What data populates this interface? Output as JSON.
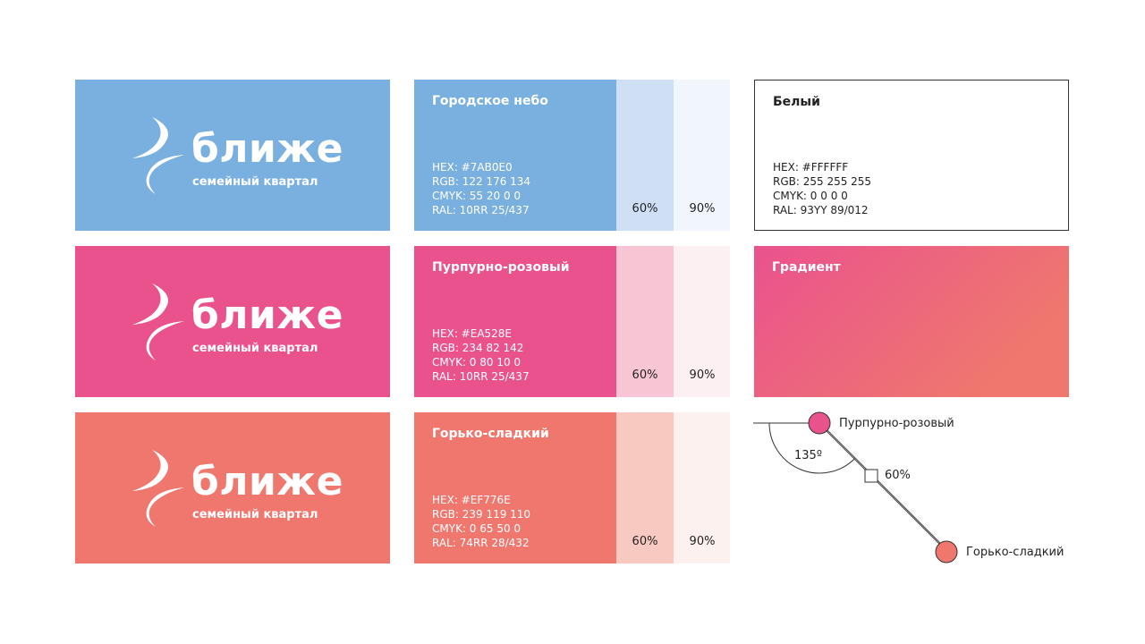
{
  "brand": {
    "wordmark": "ближе",
    "tagline": "семейный квартал"
  },
  "logo_cards": [
    {
      "background": "#7AB0E0"
    },
    {
      "background": "#EA528E"
    },
    {
      "background": "#EF776E"
    }
  ],
  "colors": [
    {
      "name": "Городское небо",
      "hex": "HEX: #7AB0E0",
      "rgb": "RGB: 122 176 134",
      "cmyk": "CMYK: 55 20 0 0",
      "ral": "RAL: 10RR 25/437",
      "tint60_label": "60%",
      "tint90_label": "90%",
      "main_color": "#7AB0E0",
      "tint60_color": "#CFE0F5",
      "tint90_color": "#F1F6FD"
    },
    {
      "name": "Пурпурно-розовый",
      "hex": "HEX: #EA528E",
      "rgb": "RGB: 234 82 142",
      "cmyk": "CMYK: 0 80 10 0",
      "ral": "RAL: 10RR 25/437",
      "tint60_label": "60%",
      "tint90_label": "90%",
      "main_color": "#EA528E",
      "tint60_color": "#F7C5D4",
      "tint90_color": "#FCF0F3"
    },
    {
      "name": "Горько-сладкий",
      "hex": "HEX: #EF776E",
      "rgb": "RGB: 239 119 110",
      "cmyk": "CMYK: 0 65 50 0",
      "ral": "RAL: 74RR 28/432",
      "tint60_label": "60%",
      "tint90_label": "90%",
      "main_color": "#EF776E",
      "tint60_color": "#F8C9C0",
      "tint90_color": "#FCF1EF"
    }
  ],
  "white": {
    "name": "Белый",
    "hex": "HEX: #FFFFFF",
    "rgb": "RGB: 255 255 255",
    "cmyk": "CMYK: 0 0 0 0",
    "ral": "RAL: 93YY 89/012"
  },
  "gradient": {
    "name": "Градиент",
    "angle_label": "135º",
    "stop_label": "60%",
    "start_label": "Пурпурно-розовый",
    "end_label": "Горько-сладкий",
    "start_color": "#EA528E",
    "end_color": "#EF776E"
  }
}
